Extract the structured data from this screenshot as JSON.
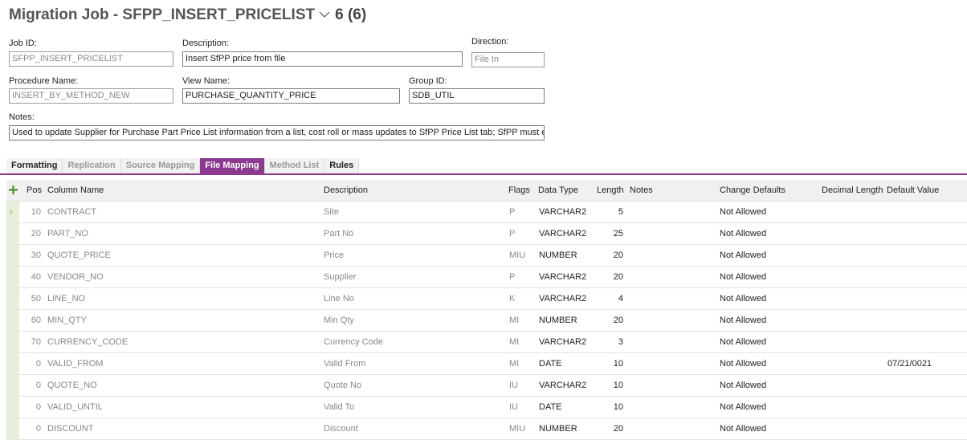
{
  "header": {
    "title": "Migration Job - SFPP_INSERT_PRICELIST",
    "count": "6 (6)"
  },
  "form": {
    "job_id_label": "Job ID:",
    "job_id": "SFPP_INSERT_PRICELIST",
    "description_label": "Description:",
    "description": "Insert SfPP price from file",
    "direction_label": "Direction:",
    "direction": "File In",
    "procedure_label": "Procedure Name:",
    "procedure": "INSERT_BY_METHOD_NEW",
    "view_label": "View Name:",
    "view": "PURCHASE_QUANTITY_PRICE",
    "group_label": "Group ID:",
    "group": "SDB_UTIL",
    "notes_label": "Notes:",
    "notes": "Used to update Supplier for Purchase Part Price List information from a list, cost roll or mass updates to SfPP Price List tab; SfPP must exist"
  },
  "tabs": [
    {
      "label": "Formatting",
      "state": "enabled"
    },
    {
      "label": "Replication",
      "state": "disabled"
    },
    {
      "label": "Source Mapping",
      "state": "disabled"
    },
    {
      "label": "File Mapping",
      "state": "active"
    },
    {
      "label": "Method List",
      "state": "disabled"
    },
    {
      "label": "Rules",
      "state": "enabled"
    }
  ],
  "columns": {
    "pos": "Pos",
    "column_name": "Column Name",
    "description": "Description",
    "flags": "Flags",
    "data_type": "Data Type",
    "length": "Length",
    "notes": "Notes",
    "change_defaults": "Change Defaults",
    "decimal_length": "Decimal Length",
    "default_value": "Default Value"
  },
  "rows": [
    {
      "pos": "10",
      "column": "CONTRACT",
      "desc": "Site",
      "flags": "P",
      "type": "VARCHAR2",
      "length": "5",
      "change": "Not Allowed",
      "default": ""
    },
    {
      "pos": "20",
      "column": "PART_NO",
      "desc": "Part No",
      "flags": "P",
      "type": "VARCHAR2",
      "length": "25",
      "change": "Not Allowed",
      "default": ""
    },
    {
      "pos": "30",
      "column": "QUOTE_PRICE",
      "desc": "Price",
      "flags": "MIU",
      "type": "NUMBER",
      "length": "20",
      "change": "Not Allowed",
      "default": ""
    },
    {
      "pos": "40",
      "column": "VENDOR_NO",
      "desc": "Supplier",
      "flags": "P",
      "type": "VARCHAR2",
      "length": "20",
      "change": "Not Allowed",
      "default": ""
    },
    {
      "pos": "50",
      "column": "LINE_NO",
      "desc": "Line No",
      "flags": "K",
      "type": "VARCHAR2",
      "length": "4",
      "change": "Not Allowed",
      "default": ""
    },
    {
      "pos": "60",
      "column": "MIN_QTY",
      "desc": "Min Qty",
      "flags": "MI",
      "type": "NUMBER",
      "length": "20",
      "change": "Not Allowed",
      "default": ""
    },
    {
      "pos": "70",
      "column": "CURRENCY_CODE",
      "desc": "Currency Code",
      "flags": "MI",
      "type": "VARCHAR2",
      "length": "3",
      "change": "Not Allowed",
      "default": ""
    },
    {
      "pos": "0",
      "column": "VALID_FROM",
      "desc": "Valid From",
      "flags": "MI",
      "type": "DATE",
      "length": "10",
      "change": "Not Allowed",
      "default": "07/21/0021"
    },
    {
      "pos": "0",
      "column": "QUOTE_NO",
      "desc": "Quote No",
      "flags": "IU",
      "type": "VARCHAR2",
      "length": "10",
      "change": "Not Allowed",
      "default": ""
    },
    {
      "pos": "0",
      "column": "VALID_UNTIL",
      "desc": "Valid To",
      "flags": "IU",
      "type": "DATE",
      "length": "10",
      "change": "Not Allowed",
      "default": ""
    },
    {
      "pos": "0",
      "column": "DISCOUNT",
      "desc": "Discount",
      "flags": "MIU",
      "type": "NUMBER",
      "length": "20",
      "change": "Not Allowed",
      "default": ""
    }
  ],
  "colors": {
    "accent": "#8b3a8f",
    "selector": "#e6efd9",
    "add_icon": "#3a8a1a"
  },
  "icons": {
    "title_dropdown": "chevron-down-icon",
    "add_row": "plus-icon"
  }
}
